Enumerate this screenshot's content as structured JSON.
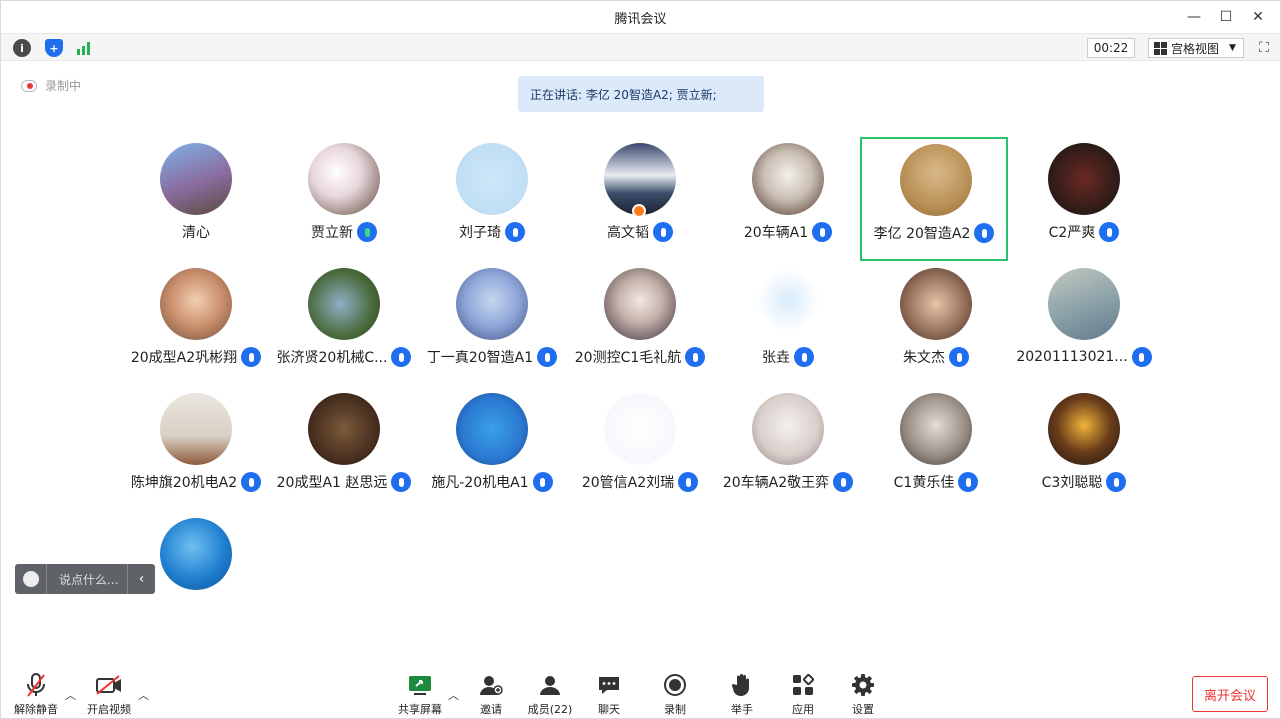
{
  "window": {
    "title": "腾讯会议"
  },
  "toolbar": {
    "timer": "00:22",
    "view_label": "宫格视图"
  },
  "recording": {
    "label": "录制中"
  },
  "speaking": {
    "text": "正在讲话: 李亿 20智造A2; 贾立新;"
  },
  "participants": [
    {
      "name": "清心",
      "mic": false
    },
    {
      "name": "贾立新",
      "mic": true,
      "speaking": true
    },
    {
      "name": "刘子琦",
      "mic": true
    },
    {
      "name": "高文韬",
      "mic": true,
      "host": true
    },
    {
      "name": "20车辆A1",
      "mic": true
    },
    {
      "name": "李亿 20智造A2",
      "mic": true,
      "active": true
    },
    {
      "name": "C2严爽",
      "mic": true
    },
    {
      "name": "20成型A2巩彬翔",
      "mic": true
    },
    {
      "name": "张济贤20机械C...",
      "mic": true
    },
    {
      "name": "丁一真20智造A1",
      "mic": true
    },
    {
      "name": "20测控C1毛礼航",
      "mic": true
    },
    {
      "name": "张垚",
      "mic": true
    },
    {
      "name": "朱文杰",
      "mic": true
    },
    {
      "name": "20201113021...",
      "mic": true
    },
    {
      "name": "陈坤旗20机电A2",
      "mic": true
    },
    {
      "name": "20成型A1 赵思远",
      "mic": true
    },
    {
      "name": "施凡-20机电A1",
      "mic": true
    },
    {
      "name": "20管信A2刘瑞",
      "mic": true
    },
    {
      "name": "20车辆A2敬王弈",
      "mic": true
    },
    {
      "name": "C1黄乐佳",
      "mic": true
    },
    {
      "name": "C3刘聪聪",
      "mic": true
    },
    {
      "name": "",
      "mic": false
    }
  ],
  "chat": {
    "placeholder": "说点什么..."
  },
  "bottom": {
    "unmute": "解除静音",
    "start_video": "开启视频",
    "share": "共享屏幕",
    "invite": "邀请",
    "members": "成员(22)",
    "chat": "聊天",
    "record": "录制",
    "raise_hand": "举手",
    "apps": "应用",
    "settings": "设置",
    "leave": "离开会议"
  },
  "colors": {
    "accent": "#1f6ef0",
    "active_border": "#27c26b",
    "leave": "#e33333"
  }
}
